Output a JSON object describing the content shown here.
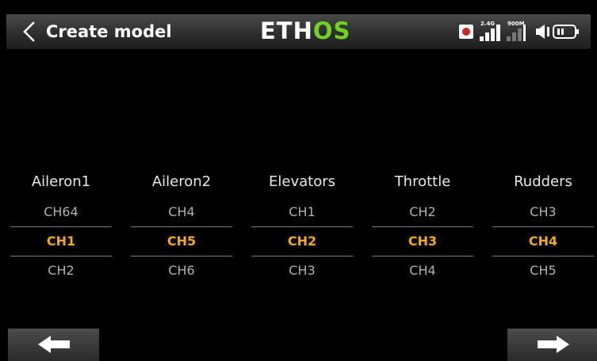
{
  "header": {
    "title": "Create model",
    "logo": {
      "prefix": "ETH",
      "highlight": "OS"
    },
    "status": {
      "rx1_label": "2.4G",
      "rx2_label": "900M",
      "rx1_signal_bars": 4,
      "rx2_signal_bars": 0,
      "icons": [
        "record-icon",
        "signal-24g-icon",
        "signal-900m-icon",
        "speaker-icon",
        "battery-icon"
      ]
    }
  },
  "mapping": {
    "columns": [
      {
        "name": "Aileron1",
        "prev": "CH64",
        "selected": "CH1",
        "next": "CH2"
      },
      {
        "name": "Aileron2",
        "prev": "CH4",
        "selected": "CH5",
        "next": "CH6"
      },
      {
        "name": "Elevators",
        "prev": "CH1",
        "selected": "CH2",
        "next": "CH3"
      },
      {
        "name": "Throttle",
        "prev": "CH2",
        "selected": "CH3",
        "next": "CH4"
      },
      {
        "name": "Rudders",
        "prev": "CH3",
        "selected": "CH4",
        "next": "CH5"
      }
    ]
  },
  "nav": {
    "prev_icon": "arrow-left-icon",
    "next_icon": "arrow-right-icon"
  },
  "colors": {
    "background": "#000000",
    "selected": "#f7a81b",
    "logo_accent": "#6fd41f",
    "record": "#d61f1f"
  }
}
